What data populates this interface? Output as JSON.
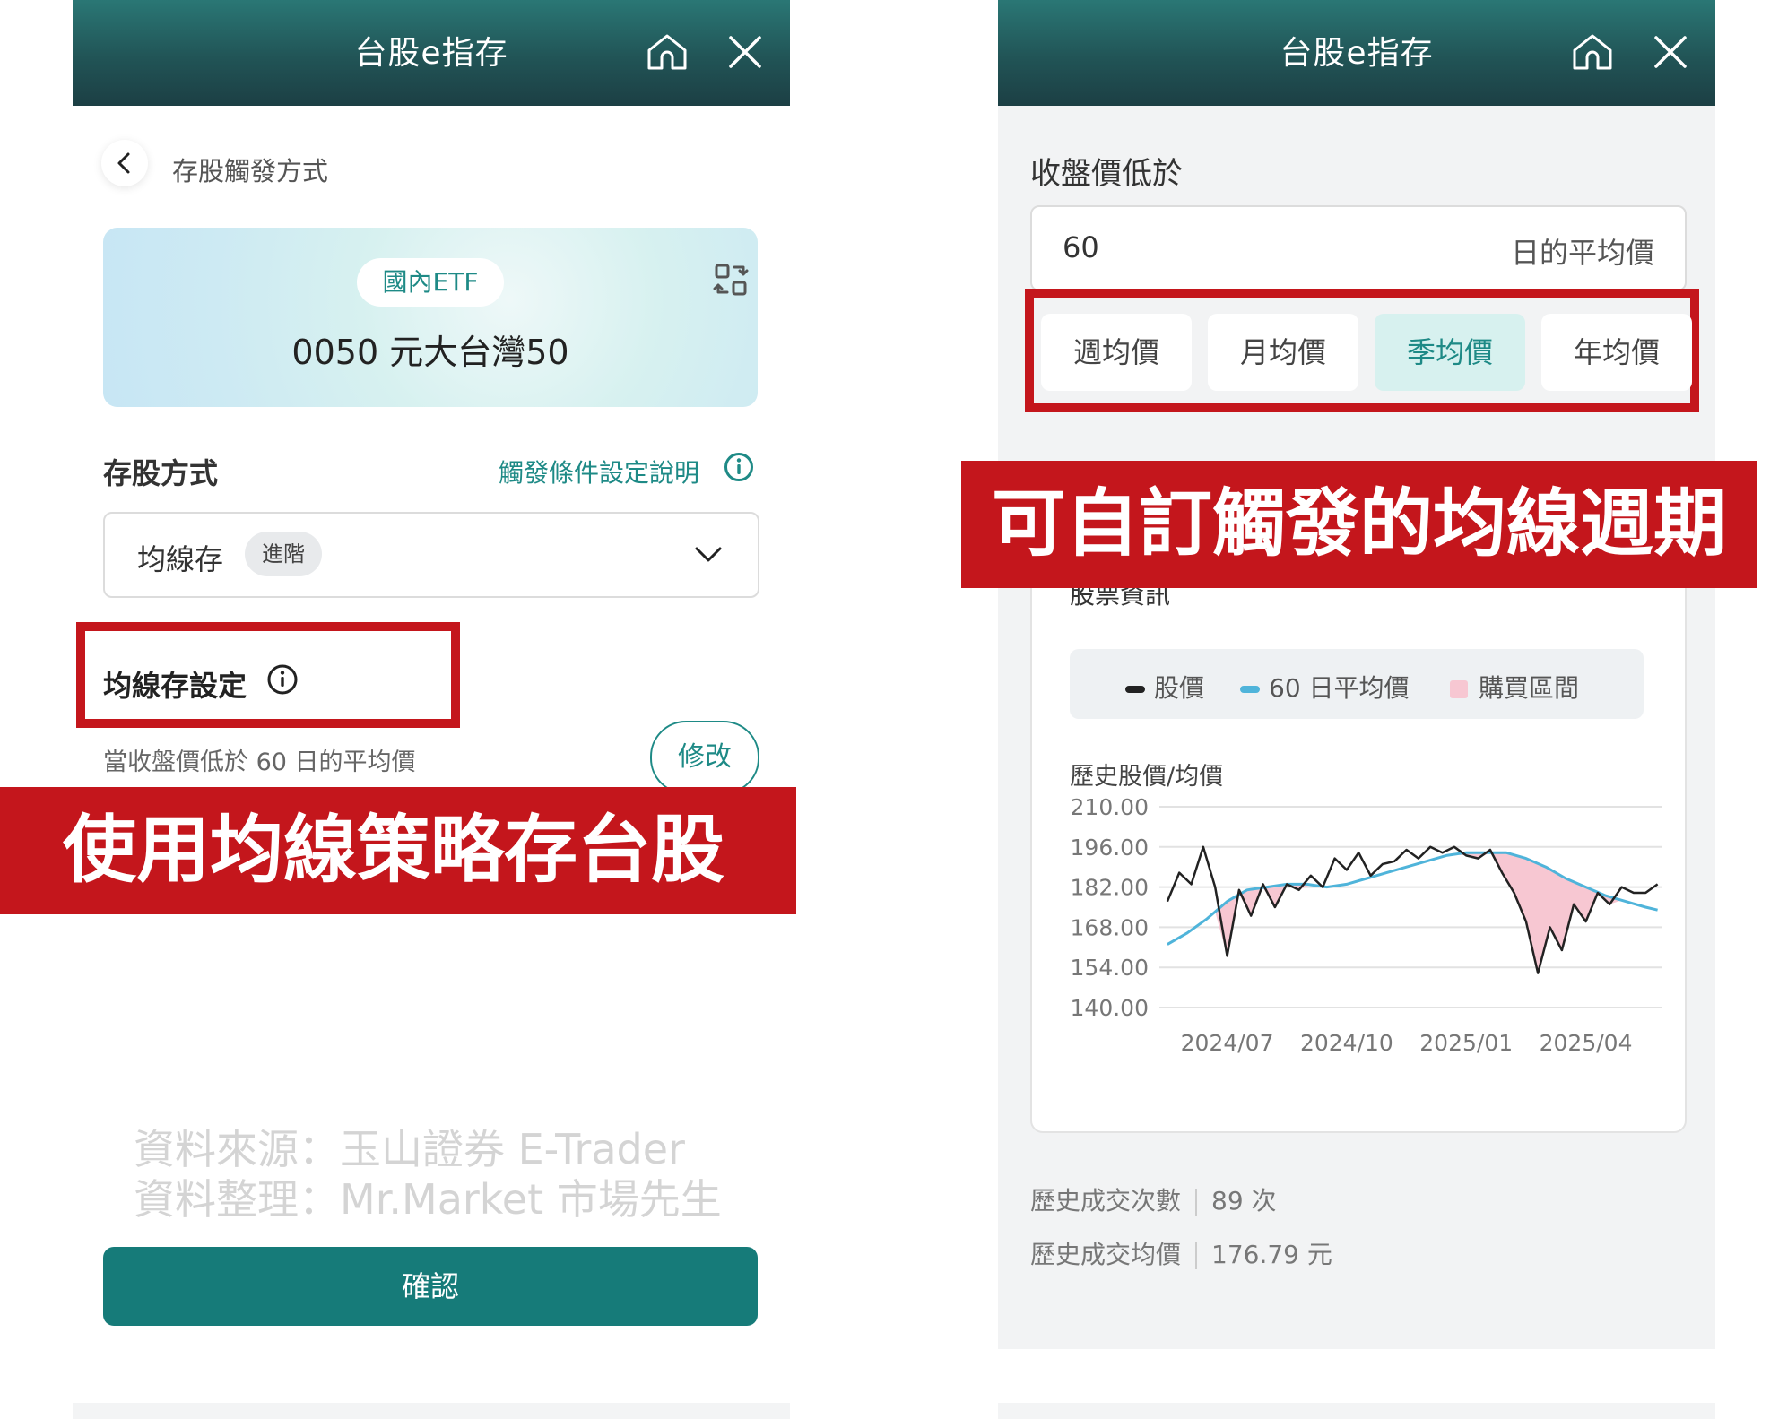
{
  "app_title": "台股e指存",
  "left": {
    "breadcrumb": "存股觸發方式",
    "etf_badge": "國內ETF",
    "stock": "0050  元大台灣50",
    "method_label": "存股方式",
    "help_link": "觸發條件設定說明",
    "method_value": "均線存",
    "method_badge": "進階",
    "setting_title": "均線存設定",
    "setting_desc": "當收盤價低於 60 日的平均價",
    "edit_label": "修改",
    "banner": "使用均線策略存台股",
    "source_line1": "資料來源：玉山證券 E-Trader",
    "source_line2": "資料整理：Mr.Market 市場先生",
    "confirm_label": "確認"
  },
  "right": {
    "condition_label": "收盤價低於",
    "period_value": "60",
    "period_unit": "日的平均價",
    "tabs": [
      "週均價",
      "月均價",
      "季均價",
      "年均價"
    ],
    "active_tab": "季均價",
    "banner": "可自訂觸發的均線週期",
    "card_header_partial": "股票資訊",
    "legend": {
      "price": "股價",
      "ma": "60 日平均價",
      "buy": "購買區間"
    },
    "chart_title": "歷史股價/均價",
    "stats": [
      {
        "label": "歷史成交次數",
        "value": "89 次"
      },
      {
        "label": "歷史成交均價",
        "value": "176.79 元"
      }
    ]
  },
  "colors": {
    "teal": "#1e8a86",
    "header_dark": "#1c3f44",
    "banner_red": "#c4161c",
    "ma_line": "#4fb4da",
    "buy_fill": "#f7c7d2"
  },
  "chart_data": {
    "type": "line",
    "title": "歷史股價/均價",
    "ylim": [
      140,
      210
    ],
    "y_ticks": [
      "210.00",
      "196.00",
      "182.00",
      "168.00",
      "154.00",
      "140.00"
    ],
    "x_ticks": [
      "2024/07",
      "2024/10",
      "2025/01",
      "2025/04"
    ],
    "x_tick_positions_month": [
      6,
      9,
      12,
      15
    ],
    "grid": true,
    "legend_position": "top",
    "series": [
      {
        "name": "股價",
        "color": "#222222",
        "months": [
          4.5,
          4.8,
          5.1,
          5.4,
          5.7,
          6.0,
          6.3,
          6.6,
          6.9,
          7.2,
          7.5,
          7.8,
          8.1,
          8.4,
          8.7,
          9.0,
          9.3,
          9.6,
          9.9,
          10.2,
          10.5,
          10.8,
          11.1,
          11.4,
          11.7,
          12.0,
          12.3,
          12.6,
          12.9,
          13.2,
          13.5,
          13.8,
          14.1,
          14.4,
          14.7,
          15.0,
          15.3,
          15.6,
          15.9,
          16.2,
          16.5,
          16.8
        ],
        "values": [
          177,
          187,
          183,
          196,
          182,
          158,
          181,
          172,
          183,
          175,
          183,
          181,
          186,
          182,
          192,
          188,
          194,
          186,
          190,
          191,
          195,
          192,
          196,
          194,
          196,
          193,
          192,
          195,
          187,
          180,
          170,
          152,
          168,
          160,
          176,
          170,
          180,
          176,
          182,
          180,
          180,
          183
        ]
      },
      {
        "name": "60 日平均價",
        "color": "#4fb4da",
        "months": [
          4.5,
          5.0,
          5.5,
          6.0,
          6.5,
          7.0,
          7.5,
          8.0,
          8.5,
          9.0,
          9.5,
          10.0,
          10.5,
          11.0,
          11.5,
          12.0,
          12.5,
          13.0,
          13.5,
          14.0,
          14.5,
          15.0,
          15.5,
          16.0,
          16.5,
          16.8
        ],
        "values": [
          162,
          166,
          171,
          177,
          181,
          182,
          183,
          183,
          182,
          183,
          185,
          187,
          189,
          191,
          193,
          194,
          194,
          194,
          192,
          189,
          185,
          182,
          179,
          177,
          175,
          174
        ]
      }
    ]
  }
}
